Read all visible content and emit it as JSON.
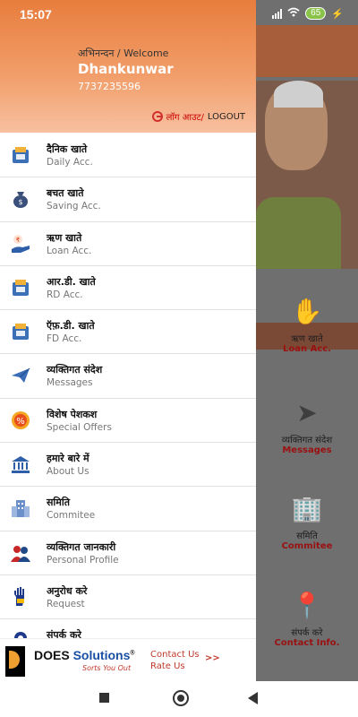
{
  "status": {
    "time": "15:07",
    "battery": "65"
  },
  "drawer": {
    "greeting": "अभिनन्दन / Welcome",
    "user_name": "Dhankunwar",
    "phone": "7737235596",
    "logout_hi": "लॉग आउट/",
    "logout_en": " LOGOUT"
  },
  "menu": [
    {
      "hi": "दैनिक खाते",
      "en": "Daily Acc.",
      "icon": "daily-account-icon"
    },
    {
      "hi": "बचत खाते",
      "en": "Saving Acc.",
      "icon": "money-bag-icon"
    },
    {
      "hi": "ऋण खाते",
      "en": "Loan Acc.",
      "icon": "loan-hand-icon"
    },
    {
      "hi": "आर.डी. खाते",
      "en": "RD Acc.",
      "icon": "rd-account-icon"
    },
    {
      "hi": "ऍफ़.डी. खाते",
      "en": "FD Acc.",
      "icon": "fd-account-icon"
    },
    {
      "hi": "व्यक्तिगत संदेश",
      "en": "Messages",
      "icon": "paper-plane-icon"
    },
    {
      "hi": "विशेष पेशकश",
      "en": "Special Offers",
      "icon": "offer-badge-icon"
    },
    {
      "hi": "हमारे बारे में",
      "en": "About Us",
      "icon": "bank-building-icon"
    },
    {
      "hi": "समिति",
      "en": "Commitee",
      "icon": "committee-building-icon"
    },
    {
      "hi": "व्यक्तिगत जानकारी",
      "en": "Personal Profile",
      "icon": "people-icon"
    },
    {
      "hi": "अनुरोध करे",
      "en": "Request",
      "icon": "hand-request-icon"
    },
    {
      "hi": "संपर्क करे",
      "en": "",
      "icon": "location-pin-icon"
    }
  ],
  "background_tiles": [
    {
      "hi": "ऋण खाते",
      "en": "Loan Acc."
    },
    {
      "hi": "व्यक्तिगत संदेश",
      "en": "Messages"
    },
    {
      "hi": "समिति",
      "en": "Commitee"
    },
    {
      "hi": "संपर्क करे",
      "en": "Contact Info."
    }
  ],
  "footer": {
    "brand_does": "DOES ",
    "brand_solutions": "Solutions",
    "registered": "®",
    "tagline": "Sorts You Out",
    "contact_us": "Contact Us",
    "rate_us": "Rate Us",
    "arrow": ">>"
  },
  "colors": {
    "header_orange": "#e87d3d",
    "accent_red": "#c0392b",
    "brand_blue": "#1a4fa3"
  }
}
